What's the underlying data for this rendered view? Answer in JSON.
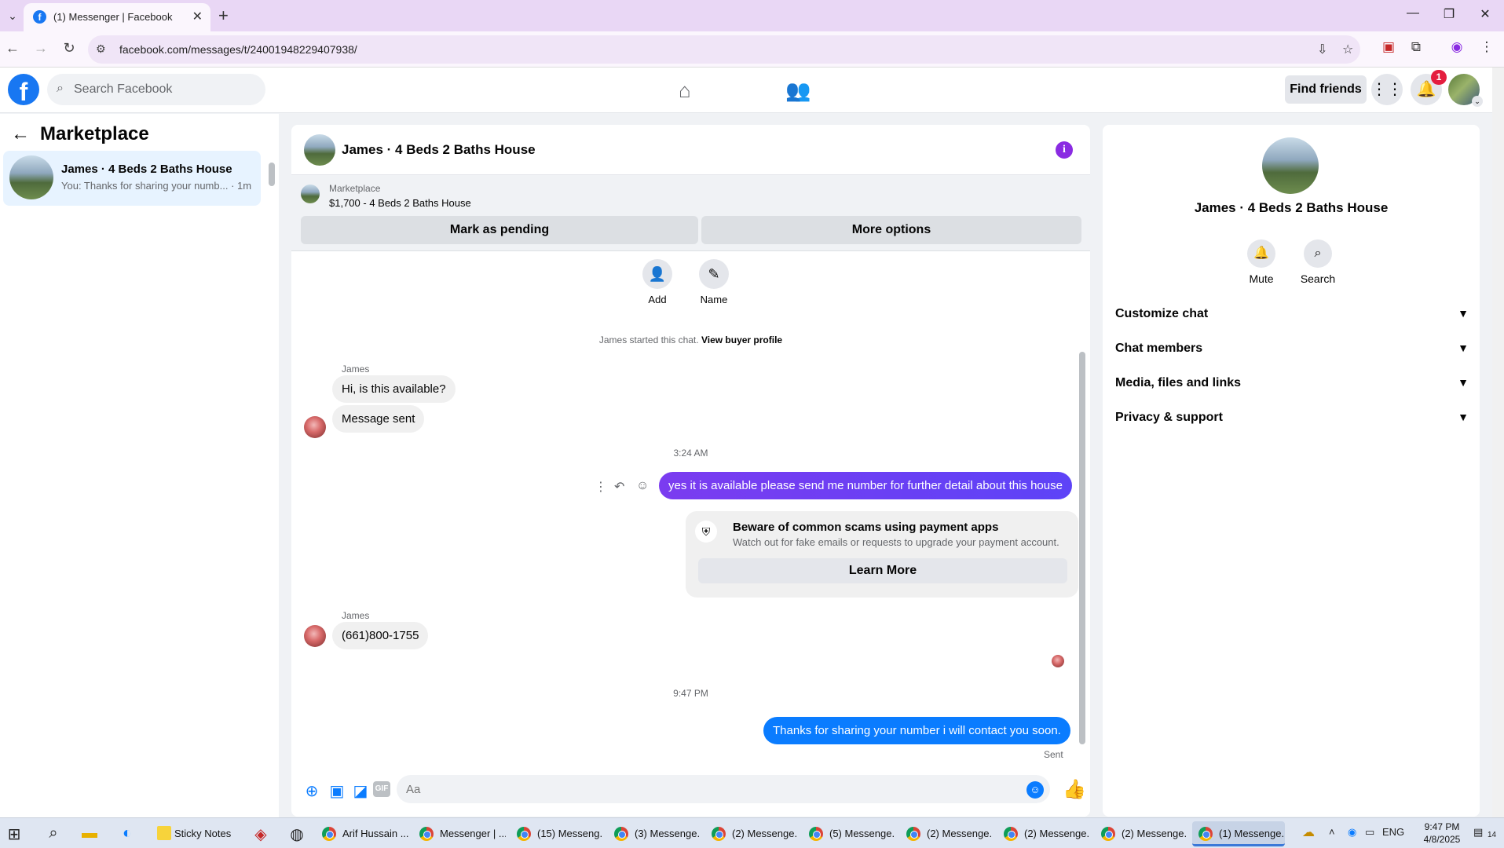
{
  "browser": {
    "tab_title": "(1) Messenger | Facebook",
    "url": "facebook.com/messages/t/24001948229407938/"
  },
  "fb_nav": {
    "search_placeholder": "Search Facebook",
    "find_friends": "Find friends",
    "notification_count": "1"
  },
  "left_panel": {
    "heading": "Marketplace",
    "chats": [
      {
        "name": "James · 4 Beds 2 Baths House",
        "preview": "You: Thanks for sharing your numb... · 1m"
      }
    ]
  },
  "conversation": {
    "title": "James · 4 Beds 2 Baths House",
    "listing": {
      "category": "Marketplace",
      "price_title": "$1,700 - 4 Beds 2 Baths House",
      "mark_pending": "Mark as pending",
      "more_options": "More options"
    },
    "actions": [
      {
        "label": "Add"
      },
      {
        "label": "Name"
      }
    ],
    "started_text": "James started this chat.",
    "view_profile": "View buyer profile",
    "messages": {
      "sender_1": "James",
      "in_1": "Hi, is this available?",
      "in_2": "Message sent",
      "time_1": "3:24 AM",
      "out_1": "yes it is available please send me number for further detail about this house",
      "scam_title": "Beware of common scams using payment apps",
      "scam_sub": "Watch out for fake emails or requests to upgrade your payment account.",
      "learn_more": "Learn More",
      "sender_2": "James",
      "in_3": "(661)800-1755",
      "time_2": "9:47 PM",
      "out_2": "Thanks for sharing your number i will contact you soon.",
      "status": "Sent"
    },
    "composer_placeholder": "Aa"
  },
  "info_panel": {
    "name": "James · 4 Beds 2 Baths House",
    "actions": [
      {
        "label": "Mute"
      },
      {
        "label": "Search"
      }
    ],
    "sections": [
      {
        "label": "Customize chat"
      },
      {
        "label": "Chat members"
      },
      {
        "label": "Media, files and links"
      },
      {
        "label": "Privacy & support"
      }
    ]
  },
  "taskbar": {
    "apps": [
      {
        "label": "Sticky Notes"
      },
      {
        "label": "Arif Hussain ..."
      },
      {
        "label": "Messenger | ..."
      },
      {
        "label": "(15) Messeng..."
      },
      {
        "label": "(3) Messenge..."
      },
      {
        "label": "(2) Messenge..."
      },
      {
        "label": "(5) Messenge..."
      },
      {
        "label": "(2) Messenge..."
      },
      {
        "label": "(2) Messenge..."
      },
      {
        "label": "(2) Messenge..."
      },
      {
        "label": "(1) Messenge..."
      }
    ],
    "language": "ENG",
    "time": "9:47 PM",
    "date": "4/8/2025",
    "notification_count": "14"
  },
  "colors": {
    "fb_blue": "#1877f2",
    "messenger_purple": "#7b3cf0",
    "messenger_blue": "#0a7cff",
    "chrome_tabstrip": "#e9d7f5"
  },
  "icons": {
    "tab_favicon": "facebook-icon",
    "home": "home-icon",
    "friends": "friends-icon",
    "menu": "grid-menu-icon",
    "bell": "bell-icon",
    "info": "info-icon",
    "shield": "shield-icon"
  }
}
